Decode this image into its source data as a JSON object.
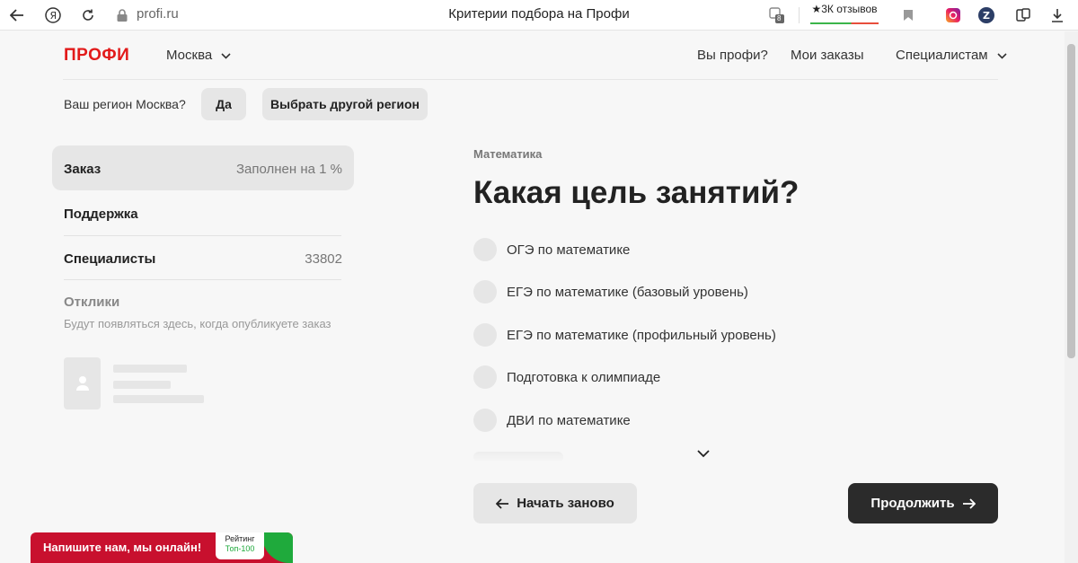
{
  "browser": {
    "url": "profi.ru",
    "tab_title": "Критерии подбора на Профи",
    "reviews_label": "★3К отзывов",
    "notif_count": "8"
  },
  "header": {
    "logo": "ПРОФИ",
    "city": "Москва",
    "nav": [
      "Вы профи?",
      "Мои заказы",
      "Специалистам"
    ]
  },
  "region": {
    "question": "Ваш регион Москва?",
    "yes_label": "Да",
    "other_label": "Выбрать другой регион"
  },
  "sidebar": {
    "order_label": "Заказ",
    "order_value": "Заполнен на 1 %",
    "support_label": "Поддержка",
    "specialists_label": "Специалисты",
    "specialists_count": "33802",
    "responses_title": "Отклики",
    "responses_sub": "Будут появляться здесь, когда опубликуете заказ"
  },
  "main": {
    "subject": "Математика",
    "question": "Какая цель занятий?",
    "options": [
      "ОГЭ по математике",
      "ЕГЭ по математике (базовый уровень)",
      "ЕГЭ по математике (профильный уровень)",
      "Подготовка к олимпиаде",
      "ДВИ по математике"
    ],
    "restart_label": "Начать заново",
    "continue_label": "Продолжить"
  },
  "chat": {
    "label": "Напишите нам, мы онлайн!",
    "badge_line1": "Рейтинг",
    "badge_line2": "Топ-100"
  },
  "colors": {
    "brand": "#e21a1a",
    "chat": "#c8102e",
    "primary_button": "#2b2b2b"
  }
}
